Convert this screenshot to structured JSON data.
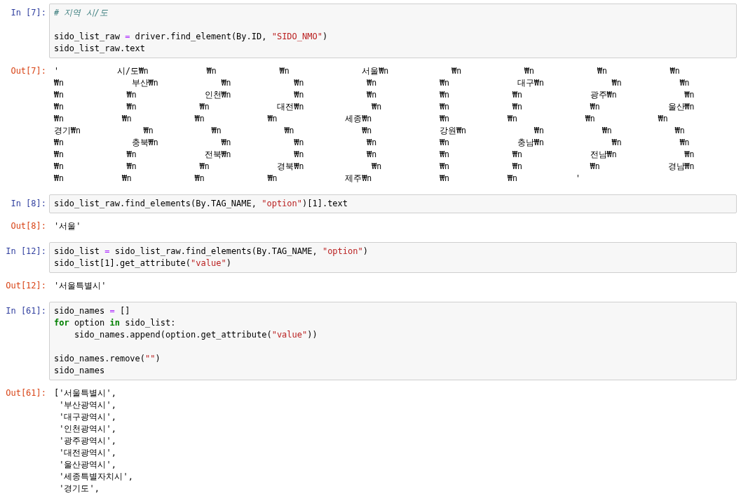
{
  "cells": [
    {
      "input": {
        "prompt": "In [7]:",
        "lines": [
          [
            {
              "kind": "comment",
              "text": "# 지역 시/도"
            }
          ],
          [
            {
              "kind": "blank"
            }
          ],
          [
            {
              "kind": "plain",
              "text": "sido_list_raw "
            },
            {
              "kind": "operator",
              "text": "="
            },
            {
              "kind": "plain",
              "text": " driver.find_element(By.ID, "
            },
            {
              "kind": "string",
              "text": "\"SIDO_NMO\""
            },
            {
              "kind": "plain",
              "text": ")"
            }
          ],
          [
            {
              "kind": "plain",
              "text": "sido_list_raw.text"
            }
          ]
        ]
      },
      "output": {
        "prompt": "Out[7]:",
        "kind": "wide",
        "lines": [
          "'            시/도₩n            ₩n             ₩n               서울₩n             ₩n             ₩n             ₩n             ₩n",
          "₩n              부산₩n             ₩n             ₩n             ₩n             ₩n              대구₩n              ₩n            ₩n",
          "₩n             ₩n              인천₩n             ₩n             ₩n             ₩n             ₩n              광주₩n              ₩n",
          "₩n             ₩n             ₩n              대전₩n              ₩n            ₩n             ₩n              ₩n              울산₩n",
          "₩n            ₩n             ₩n             ₩n              세종₩n              ₩n            ₩n              ₩n             ₩n",
          "경기₩n             ₩n            ₩n             ₩n              ₩n              강원₩n              ₩n            ₩n             ₩n",
          "₩n              충북₩n             ₩n             ₩n             ₩n             ₩n              충남₩n              ₩n            ₩n",
          "₩n             ₩n              전북₩n             ₩n             ₩n             ₩n             ₩n              전남₩n              ₩n",
          "₩n             ₩n             ₩n              경북₩n              ₩n            ₩n             ₩n              ₩n              경남₩n",
          "₩n            ₩n             ₩n             ₩n              제주₩n              ₩n            ₩n            '"
        ]
      }
    },
    {
      "input": {
        "prompt": "In [8]:",
        "lines": [
          [
            {
              "kind": "plain",
              "text": "sido_list_raw.find_elements(By.TAG_NAME, "
            },
            {
              "kind": "string",
              "text": "\"option\""
            },
            {
              "kind": "plain",
              "text": ")[1].text"
            }
          ]
        ]
      },
      "output": {
        "prompt": "Out[8]:",
        "kind": "normal",
        "lines": [
          "'서울'"
        ]
      }
    },
    {
      "input": {
        "prompt": "In [12]:",
        "lines": [
          [
            {
              "kind": "plain",
              "text": "sido_list "
            },
            {
              "kind": "operator",
              "text": "="
            },
            {
              "kind": "plain",
              "text": " sido_list_raw.find_elements(By.TAG_NAME, "
            },
            {
              "kind": "string",
              "text": "\"option\""
            },
            {
              "kind": "plain",
              "text": ")"
            }
          ],
          [
            {
              "kind": "plain",
              "text": "sido_list[1].get_attribute("
            },
            {
              "kind": "string",
              "text": "\"value\""
            },
            {
              "kind": "plain",
              "text": ")"
            }
          ]
        ]
      },
      "output": {
        "prompt": "Out[12]:",
        "kind": "normal",
        "lines": [
          "'서울특별시'"
        ]
      }
    },
    {
      "input": {
        "prompt": "In [61]:",
        "lines": [
          [
            {
              "kind": "plain",
              "text": "sido_names "
            },
            {
              "kind": "operator",
              "text": "="
            },
            {
              "kind": "plain",
              "text": " []"
            }
          ],
          [
            {
              "kind": "keyword",
              "text": "for"
            },
            {
              "kind": "plain",
              "text": " option "
            },
            {
              "kind": "keyword",
              "text": "in"
            },
            {
              "kind": "plain",
              "text": " sido_list:"
            }
          ],
          [
            {
              "kind": "plain",
              "text": "    sido_names.append(option.get_attribute("
            },
            {
              "kind": "string",
              "text": "\"value\""
            },
            {
              "kind": "plain",
              "text": "))"
            }
          ],
          [
            {
              "kind": "blank"
            }
          ],
          [
            {
              "kind": "plain",
              "text": "sido_names.remove("
            },
            {
              "kind": "string",
              "text": "\"\""
            },
            {
              "kind": "plain",
              "text": ")"
            }
          ],
          [
            {
              "kind": "plain",
              "text": "sido_names"
            }
          ]
        ]
      },
      "output": {
        "prompt": "Out[61]:",
        "kind": "normal",
        "lines": [
          "['서울특별시',",
          " '부산광역시',",
          " '대구광역시',",
          " '인천광역시',",
          " '광주광역시',",
          " '대전광역시',",
          " '울산광역시',",
          " '세종특별자치시',",
          " '경기도',"
        ]
      }
    }
  ]
}
